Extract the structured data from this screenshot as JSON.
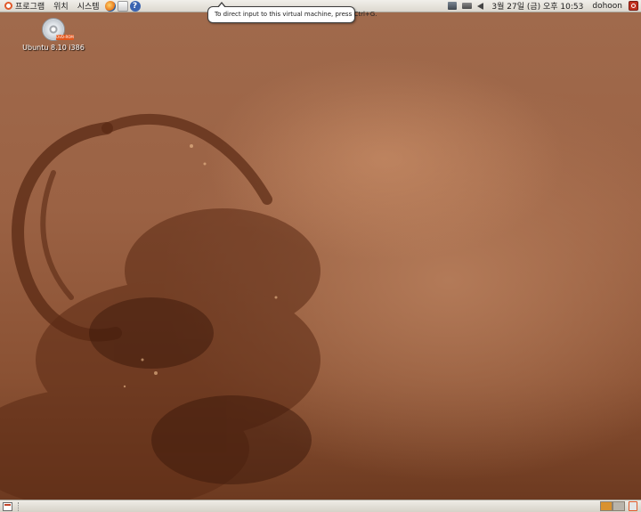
{
  "top_panel": {
    "menus": [
      {
        "label": "프로그램",
        "icon": "ubuntu-logo-icon"
      },
      {
        "label": "위치"
      },
      {
        "label": "시스템"
      }
    ],
    "launchers": [
      "firefox-icon",
      "mail-icon",
      "help-icon"
    ],
    "help_glyph": "?",
    "tray": [
      "network-icon",
      "battery-icon",
      "volume-icon"
    ],
    "clock": "3월 27일 (금) 오후 10:53",
    "user": "dohoon",
    "power_icon": "power-icon"
  },
  "tooltip": {
    "text": "To direct input to this virtual machine, press Ctrl+G."
  },
  "desktop": {
    "icons": [
      {
        "label": "Ubuntu 8.10 i386",
        "badge": "DVD-ROM",
        "icon": "dvd-disc-icon"
      }
    ]
  },
  "bottom_panel": {
    "show_desktop_icon": "show-desktop-icon",
    "workspaces": [
      "active",
      "inactive"
    ],
    "trash_icon": "trash-icon"
  },
  "colors": {
    "panel": "#e4e0d8",
    "wallpaper": "#9b6244",
    "accent": "#e0592a",
    "workspace_active": "#d9922f"
  }
}
